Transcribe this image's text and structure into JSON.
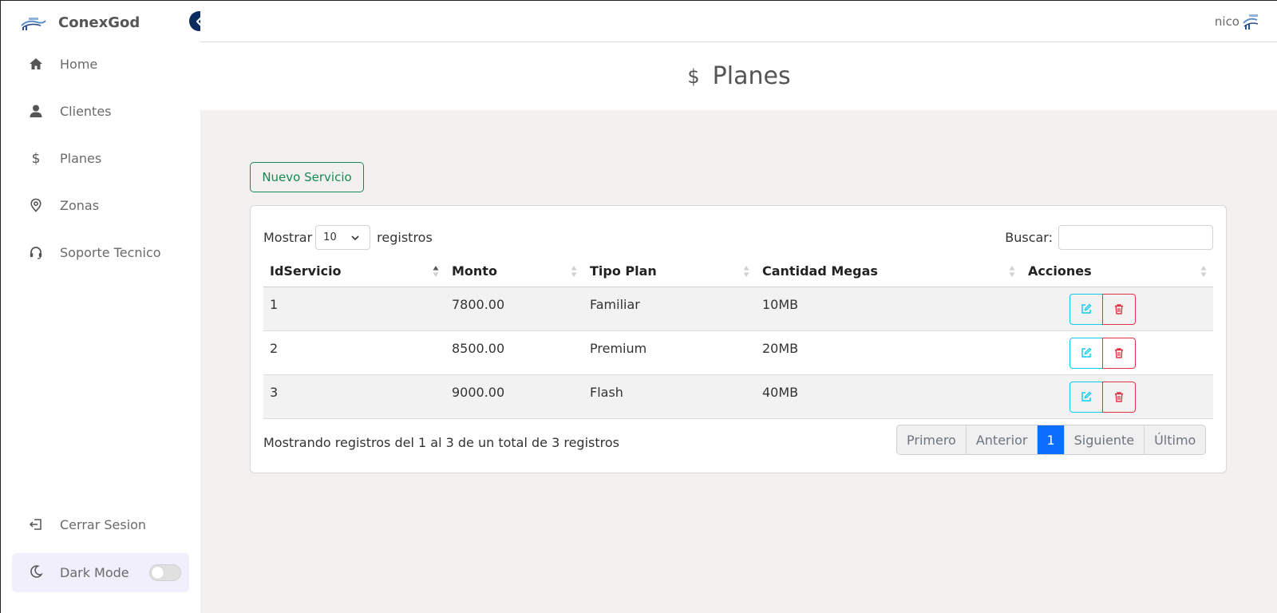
{
  "brand": {
    "name": "ConexGod"
  },
  "sidebar": {
    "items": [
      {
        "label": "Home",
        "icon": "home-icon"
      },
      {
        "label": "Clientes",
        "icon": "user-icon"
      },
      {
        "label": "Planes",
        "icon": "dollar-icon"
      },
      {
        "label": "Zonas",
        "icon": "map-pin-icon"
      },
      {
        "label": "Soporte Tecnico",
        "icon": "headset-icon"
      }
    ],
    "logout_label": "Cerrar Sesion",
    "darkmode_label": "Dark Mode",
    "darkmode_on": false
  },
  "topbar": {
    "username": "nico"
  },
  "page": {
    "title_icon": "$",
    "title": "Planes"
  },
  "toolbar": {
    "new_button": "Nuevo Servicio"
  },
  "table_controls": {
    "show_label": "Mostrar",
    "page_size": "10",
    "records_label": "registros",
    "search_label": "Buscar:",
    "search_value": ""
  },
  "table": {
    "columns": [
      "IdServicio",
      "Monto",
      "Tipo Plan",
      "Cantidad Megas",
      "Acciones"
    ],
    "rows": [
      {
        "id": "1",
        "monto": "7800.00",
        "tipo": "Familiar",
        "megas": "10MB"
      },
      {
        "id": "2",
        "monto": "8500.00",
        "tipo": "Premium",
        "megas": "20MB"
      },
      {
        "id": "3",
        "monto": "9000.00",
        "tipo": "Flash",
        "megas": "40MB"
      }
    ]
  },
  "footer": {
    "info": "Mostrando registros del 1 al 3 de un total de 3 registros",
    "pagination": {
      "first": "Primero",
      "previous": "Anterior",
      "current": "1",
      "next": "Siguiente",
      "last": "Último"
    }
  },
  "colors": {
    "accent": "#0b2a5e",
    "success": "#198754",
    "info": "#0dcaf0",
    "danger": "#dc3545",
    "primary": "#0d6efd",
    "main_bg": "#f3f1f0"
  }
}
